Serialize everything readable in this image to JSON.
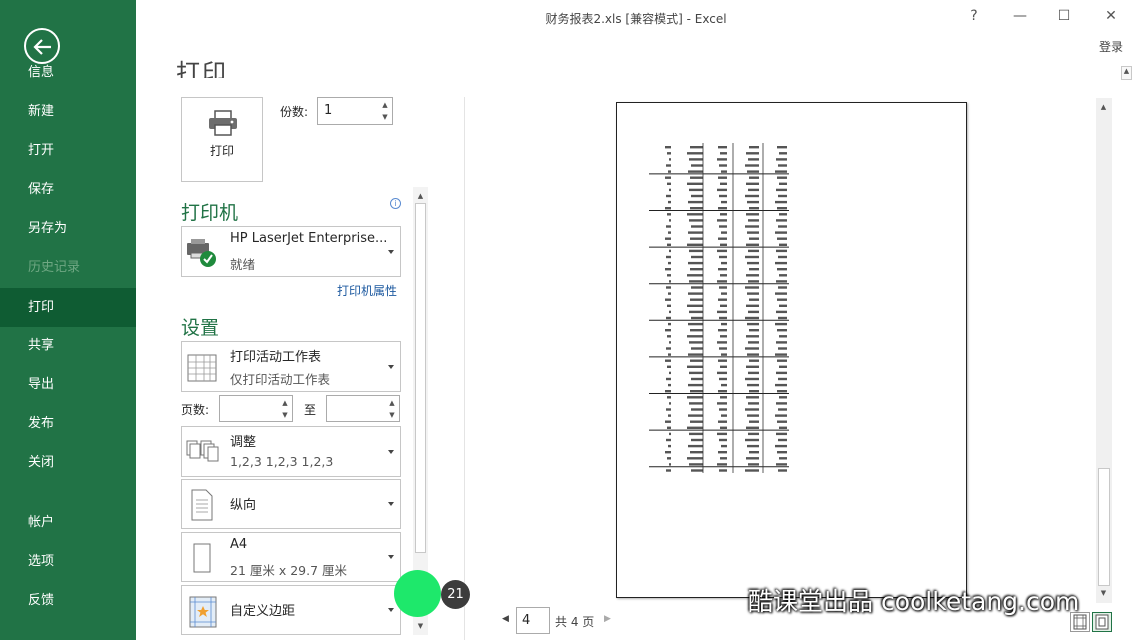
{
  "window": {
    "title": "财务报表2.xls  [兼容模式] - Excel",
    "help": "?",
    "minimize": "—",
    "maximize": "☐",
    "close": "✕",
    "login": "登录"
  },
  "sidebar": {
    "items": [
      {
        "label": "信息"
      },
      {
        "label": "新建"
      },
      {
        "label": "打开"
      },
      {
        "label": "保存"
      },
      {
        "label": "另存为"
      },
      {
        "label": "历史记录"
      },
      {
        "label": "打印"
      },
      {
        "label": "共享"
      },
      {
        "label": "导出"
      },
      {
        "label": "发布"
      },
      {
        "label": "关闭"
      },
      {
        "label": "帐户"
      },
      {
        "label": "选项"
      },
      {
        "label": "反馈"
      }
    ],
    "active": "打印",
    "disabled": "历史记录",
    "colors": {
      "background": "#217346",
      "active": "#0f5c33"
    }
  },
  "print": {
    "heading": "打印",
    "button_label": "打印",
    "copies_label": "份数:",
    "copies_value": "1"
  },
  "printer": {
    "heading": "打印机",
    "name": "HP LaserJet Enterprise...",
    "status": "就绪",
    "properties_link": "打印机属性"
  },
  "settings": {
    "heading": "设置",
    "scope": {
      "title": "打印活动工作表",
      "subtitle": "仅打印活动工作表"
    },
    "pages_label": "页数:",
    "pages_to_label": "至",
    "collate": {
      "title": "调整",
      "subtitle": "1,2,3    1,2,3    1,2,3"
    },
    "orientation": {
      "title": "纵向"
    },
    "paper": {
      "title": "A4",
      "subtitle": "21 厘米 x 29.7 厘米"
    },
    "margins": {
      "title": "自定义边距"
    }
  },
  "preview": {
    "current_page": "4",
    "total_pages": "共 4 页"
  },
  "overlay": {
    "step_number": "21",
    "watermark": "酷课堂出品 coolketang.com"
  }
}
